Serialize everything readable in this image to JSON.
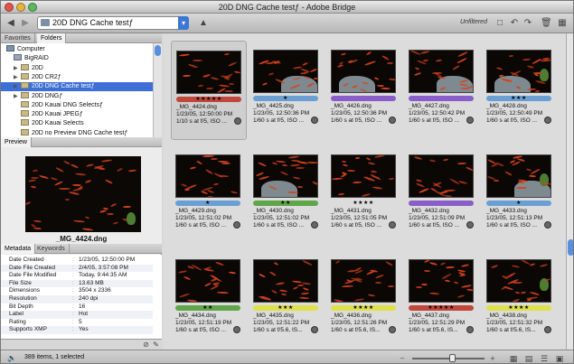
{
  "window": {
    "title": "20D DNG Cache testƒ - Adobe Bridge"
  },
  "toolbar": {
    "back_icon": "back-arrow-icon",
    "forward_icon": "forward-arrow-icon",
    "path": "20D DNG Cache testƒ",
    "filter": "Unfiltered"
  },
  "left": {
    "tabs": [
      "Favorites",
      "Folders"
    ],
    "tree": [
      {
        "label": "Computer",
        "indent": 0,
        "kind": "comp"
      },
      {
        "label": "BigRAID",
        "indent": 1,
        "kind": "disk"
      },
      {
        "label": "20D",
        "indent": 2,
        "kind": "folder"
      },
      {
        "label": "20D CR2ƒ",
        "indent": 2,
        "kind": "folder"
      },
      {
        "label": "20D DNG Cache testƒ",
        "indent": 2,
        "kind": "folder",
        "selected": true
      },
      {
        "label": "20D DNGƒ",
        "indent": 2,
        "kind": "folder"
      },
      {
        "label": "20D Kauai DNG Selectsƒ",
        "indent": 2,
        "kind": "folder"
      },
      {
        "label": "20D Kauai JPEGƒ",
        "indent": 2,
        "kind": "folder"
      },
      {
        "label": "20D Kauai Selects",
        "indent": 2,
        "kind": "folder"
      },
      {
        "label": "20D no Preview DNG Cache testƒ",
        "indent": 2,
        "kind": "folder"
      }
    ],
    "preview_tab": "Preview",
    "preview_name": "_MG_4424.dng",
    "meta_tabs": [
      "Metadata",
      "Keywords"
    ],
    "metadata": [
      {
        "k": "Date Created",
        "v": "1/23/05, 12:50:00 PM"
      },
      {
        "k": "Date File Created",
        "v": "2/4/05, 3:57:08 PM"
      },
      {
        "k": "Date File Modified",
        "v": "Today, 9:44:35 AM"
      },
      {
        "k": "File Size",
        "v": "13.63 MB"
      },
      {
        "k": "Dimensions",
        "v": "3504 x 2336"
      },
      {
        "k": "Resolution",
        "v": "240 dpi"
      },
      {
        "k": "Bit Depth",
        "v": "16"
      },
      {
        "k": "Label",
        "v": "Hot"
      },
      {
        "k": "Rating",
        "v": "5"
      },
      {
        "k": "Supports XMP",
        "v": "Yes"
      }
    ]
  },
  "colors": {
    "red": "#c0473a",
    "blue": "#6a9fd4",
    "purple": "#8a5ec9",
    "green": "#5fa64a",
    "yellow": "#dfe04a",
    "selection": "#3d6fd6"
  },
  "thumbs": [
    {
      "name": "_MG_4424.dng",
      "date": "1/23/05, 12:50:00 PM",
      "exp": "1/10 s at f/5, ISO ...",
      "label": "red",
      "stars": "★★★★★",
      "selected": true
    },
    {
      "name": "_MG_4425.dng",
      "date": "1/23/05, 12:50:36 PM",
      "exp": "1/60 s at f/5, ISO ...",
      "label": "blue",
      "stars": "★"
    },
    {
      "name": "_MG_4426.dng",
      "date": "1/23/05, 12:50:36 PM",
      "exp": "1/60 s at f/5, ISO ...",
      "label": "purple",
      "stars": ""
    },
    {
      "name": "_MG_4427.dng",
      "date": "1/23/05, 12:50:42 PM",
      "exp": "1/60 s at f/5, ISO ...",
      "label": "purple",
      "stars": ""
    },
    {
      "name": "_MG_4428.dng",
      "date": "1/23/05, 12:50:49 PM",
      "exp": "1/60 s at f/5, ISO ...",
      "label": "blue",
      "stars": "★★★"
    },
    {
      "name": "_MG_4429.dng",
      "date": "1/23/05, 12:51:02 PM",
      "exp": "1/60 s at f/5, ISO ...",
      "label": "blue",
      "stars": "★"
    },
    {
      "name": "_MG_4430.dng",
      "date": "1/23/05, 12:51:02 PM",
      "exp": "1/60 s at f/5, ISO ...",
      "label": "green",
      "stars": "★★"
    },
    {
      "name": "_MG_4431.dng",
      "date": "1/23/05, 12:51:05 PM",
      "exp": "1/60 s at f/5, ISO ...",
      "label": "none",
      "stars": "★★★★"
    },
    {
      "name": "_MG_4432.dng",
      "date": "1/23/05, 12:51:09 PM",
      "exp": "1/60 s at f/5, ISO ...",
      "label": "purple",
      "stars": ""
    },
    {
      "name": "_MG_4433.dng",
      "date": "1/23/05, 12:51:13 PM",
      "exp": "1/60 s at f/5, ISO ...",
      "label": "blue",
      "stars": "★"
    },
    {
      "name": "_MG_4434.dng",
      "date": "1/23/05, 12:51:19 PM",
      "exp": "1/60 s at f/5, ISO ...",
      "label": "green",
      "stars": "★★"
    },
    {
      "name": "_MG_4435.dng",
      "date": "1/23/05, 12:51:22 PM",
      "exp": "1/60 s at f/5.6, IS...",
      "label": "yellow",
      "stars": "★★★"
    },
    {
      "name": "_MG_4436.dng",
      "date": "1/23/05, 12:51:26 PM",
      "exp": "1/60 s at f/5.6, IS...",
      "label": "yellow",
      "stars": "★★★★"
    },
    {
      "name": "_MG_4437.dng",
      "date": "1/23/05, 12:51:29 PM",
      "exp": "1/60 s at f/5.6, IS...",
      "label": "red",
      "stars": "★★★★★"
    },
    {
      "name": "_MG_4438.dng",
      "date": "1/23/05, 12:51:32 PM",
      "exp": "1/60 s at f/5.6, IS...",
      "label": "yellow",
      "stars": "★★★★"
    }
  ],
  "status": {
    "text": "389 items, 1 selected",
    "thumb_size_fraction": 0.55
  }
}
